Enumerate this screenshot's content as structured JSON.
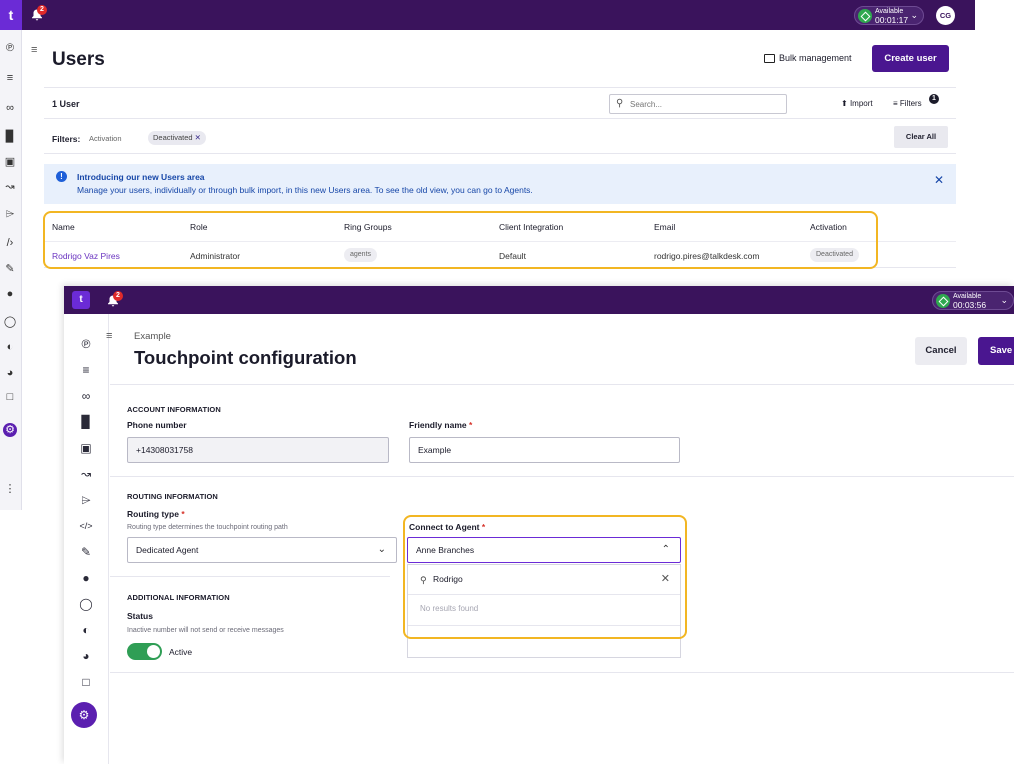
{
  "back_window": {
    "logo_letter": "t",
    "notification_count": "2",
    "status": {
      "label": "Available",
      "timer": "00:01:17"
    },
    "avatar_initials": "CG",
    "page_title": "Users",
    "bulk_management_label": "Bulk management",
    "create_user_label": "Create user",
    "user_count": "1 User",
    "search_placeholder": "Search...",
    "import_label": "Import",
    "filters_label": "Filters",
    "filters_count": "1",
    "filters_prefix": "Filters:",
    "filter_field": "Activation",
    "filter_chip": "Deactivated",
    "clear_all_label": "Clear All",
    "banner": {
      "title": "Introducing our new Users area",
      "body": "Manage your users, individually or through bulk import, in this new Users area. To see the old view, you can go to Agents.",
      "icon": "info-icon"
    },
    "table": {
      "headers": [
        "Name",
        "Role",
        "Ring Groups",
        "Client Integration",
        "Email",
        "Activation"
      ],
      "rows": [
        {
          "name": "Rodrigo Vaz Pires",
          "role": "Administrator",
          "ring_group": "agents",
          "client_integration": "Default",
          "email": "rodrigo.pires@talkdesk.com",
          "activation": "Deactivated"
        }
      ]
    }
  },
  "front_window": {
    "logo_letter": "t",
    "notification_count": "2",
    "status": {
      "label": "Available",
      "timer": "00:03:56"
    },
    "breadcrumb": "Example",
    "page_title": "Touchpoint configuration",
    "cancel_label": "Cancel",
    "save_label": "Save",
    "account_section": "ACCOUNT INFORMATION",
    "phone_label": "Phone number",
    "phone_value": "+14308031758",
    "friendly_label": "Friendly name",
    "friendly_value": "Example",
    "required_mark": "*",
    "routing_section": "ROUTING INFORMATION",
    "routing_label": "Routing type",
    "routing_help": "Routing type determines the touchpoint routing path",
    "routing_value": "Dedicated Agent",
    "agent_label": "Connect to Agent",
    "agent_value": "Anne Branches",
    "agent_search_query": "Rodrigo",
    "agent_no_results": "No results found",
    "additional_section": "ADDITIONAL INFORMATION",
    "status_label": "Status",
    "status_help": "Inactive number will not send or receive messages",
    "status_toggle": "Active",
    "status_on": true
  },
  "colors": {
    "topbar": "#3a135c",
    "primary": "#4a1690",
    "highlight": "#f2b623",
    "toggle_on": "#2f9e55",
    "link": "#6a34c0"
  }
}
